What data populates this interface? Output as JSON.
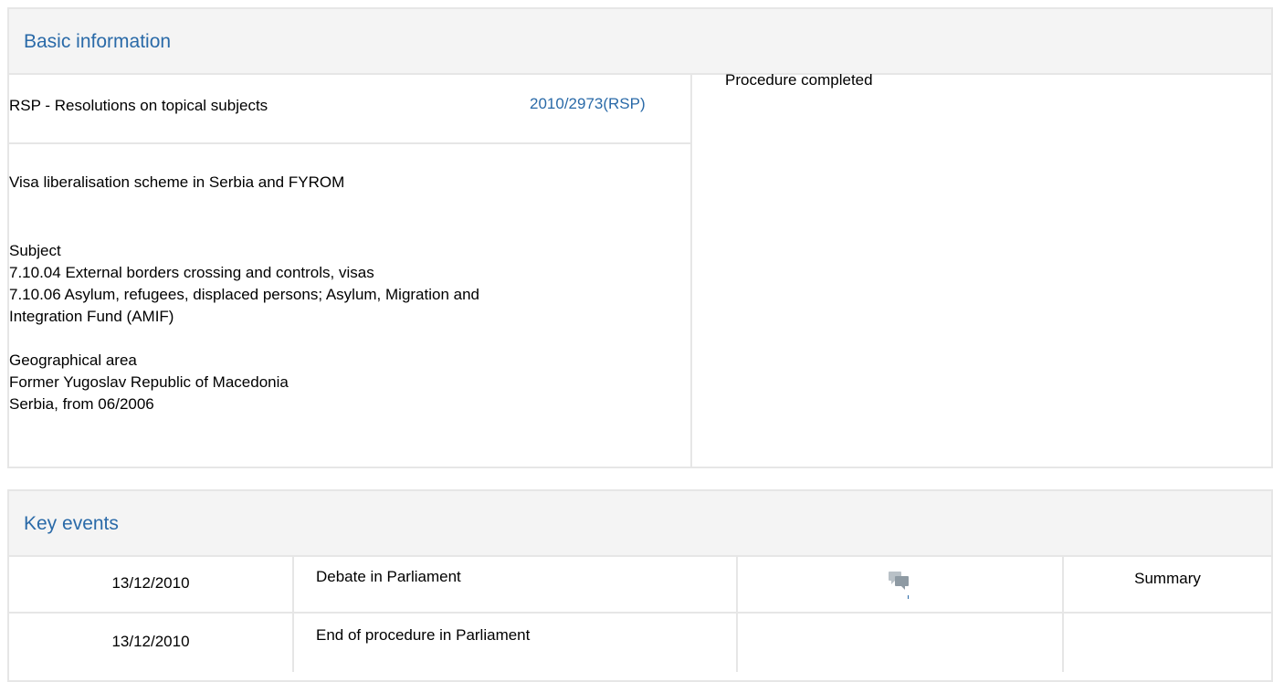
{
  "basic": {
    "heading": "Basic information",
    "procedure_type": "RSP - Resolutions on topical subjects",
    "reference": "2010/2973(RSP)",
    "status": "Procedure completed",
    "title": "Visa liberalisation scheme in Serbia and FYROM",
    "subject_label": "Subject",
    "subjects": [
      "7.10.04 External borders crossing and controls, visas",
      "7.10.06 Asylum, refugees, displaced persons; Asylum, Migration and",
      "Integration Fund (AMIF)"
    ],
    "geo_label": "Geographical area",
    "geo_areas": [
      "Former Yugoslav Republic of Macedonia",
      "Serbia, from 06/2006"
    ]
  },
  "events": {
    "heading": "Key events",
    "rows": [
      {
        "date": "13/12/2010",
        "event": "Debate in Parliament",
        "icon": "debate-icon",
        "summary": "Summary"
      },
      {
        "date": "13/12/2010",
        "event": "End of procedure in Parliament",
        "icon": "",
        "summary": ""
      }
    ]
  },
  "colors": {
    "accent": "#2a6aa8",
    "border": "#e6e6e6",
    "header_bg": "#f4f4f4"
  }
}
